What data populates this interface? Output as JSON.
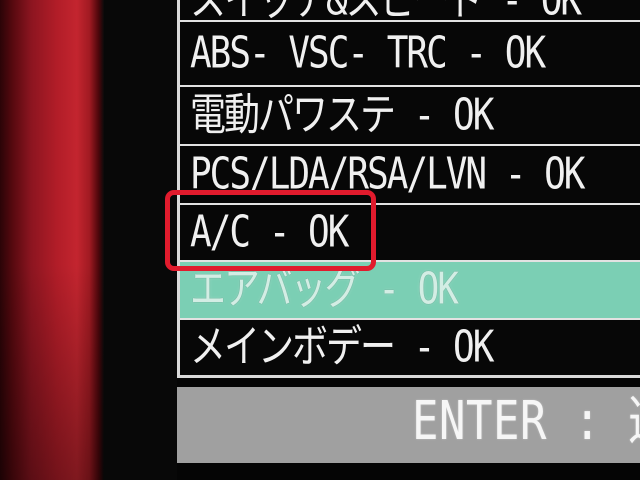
{
  "screen": {
    "rows": [
      {
        "label": "スイッチ&スピード - OK"
      },
      {
        "label": "ABS- VSC- TRC - OK"
      },
      {
        "label": "電動パワステ - OK"
      },
      {
        "label": "PCS/LDA/RSA/LVN - OK"
      },
      {
        "label": "A/C - OK",
        "annotated": true
      },
      {
        "label": "エアバッグ - OK",
        "selected": true
      },
      {
        "label": "メインボデー - OK"
      }
    ],
    "footer": {
      "hint": "ENTER : 選"
    }
  },
  "colors": {
    "selected_row": "#7bcfb4",
    "annotation_box": "#e11b2d",
    "footer_bg": "#a0a0a0",
    "list_text": "#f0f0f0",
    "device_casing": "#b21d28"
  }
}
